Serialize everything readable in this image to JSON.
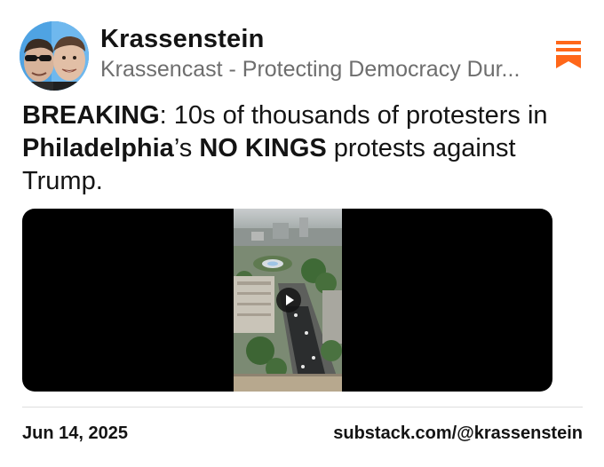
{
  "header": {
    "author_name": "Krassenstein",
    "publication": "Krassencast - Protecting Democracy Dur...",
    "logo_icon": "substack-logo-icon",
    "brand_color": "#ff6719"
  },
  "post": {
    "seg1": "BREAKING",
    "seg2": ": 10s of thousands of protesters in ",
    "seg3": "Philadelphia",
    "seg4": "’s ",
    "seg5": "NO KINGS",
    "seg6": " protests against Trump."
  },
  "media": {
    "type": "video",
    "play_icon": "play-icon"
  },
  "footer": {
    "date": "Jun 14, 2025",
    "source": "substack.com/@krassenstein"
  }
}
